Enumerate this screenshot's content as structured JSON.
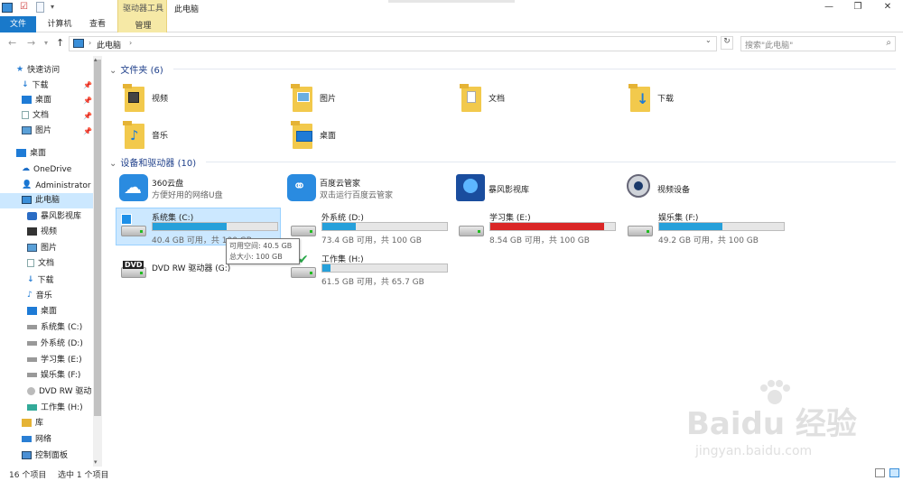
{
  "window": {
    "title": "此电脑",
    "minimize": "—",
    "restore": "❐",
    "close": "✕"
  },
  "ribbon": {
    "file_tab": "文件",
    "tabs": [
      "计算机",
      "查看"
    ],
    "tools_label": "驱动器工具",
    "manage_tab": "管理"
  },
  "address": {
    "path": "此电脑",
    "search_placeholder": "搜索\"此电脑\""
  },
  "nav": {
    "quick_access": "快速访问",
    "quick_items": [
      "下载",
      "桌面",
      "文档",
      "图片"
    ],
    "desktop": "桌面",
    "onedrive": "OneDrive",
    "user": "Administrator",
    "this_pc": "此电脑",
    "pc_items": [
      "暴风影视库",
      "视频",
      "图片",
      "文档",
      "下载",
      "音乐",
      "桌面",
      "系统集 (C:)",
      "外系统 (D:)",
      "学习集 (E:)",
      "娱乐集 (F:)",
      "DVD RW 驱动",
      "工作集 (H:)"
    ],
    "libraries": "库",
    "network": "网络",
    "control_panel": "控制面板"
  },
  "folders": {
    "heading": "文件夹 (6)",
    "items": [
      "视频",
      "图片",
      "文档",
      "下载",
      "音乐",
      "桌面"
    ]
  },
  "devices": {
    "heading": "设备和驱动器 (10)",
    "apps": [
      {
        "name": "360云盘",
        "sub": "方便好用的网络U盘"
      },
      {
        "name": "百度云管家",
        "sub": "双击运行百度云管家"
      },
      {
        "name": "暴风影视库",
        "sub": ""
      },
      {
        "name": "视频设备",
        "sub": ""
      }
    ],
    "drives": [
      {
        "name": "系统集 (C:)",
        "free": "40.4 GB 可用，共 100 GB",
        "used_pct": 59.6,
        "color": "#26a0da"
      },
      {
        "name": "外系统 (D:)",
        "free": "73.4 GB 可用，共 100 GB",
        "used_pct": 26.6,
        "color": "#26a0da"
      },
      {
        "name": "学习集 (E:)",
        "free": "8.54 GB 可用，共 100 GB",
        "used_pct": 91.5,
        "color": "#da2626"
      },
      {
        "name": "娱乐集 (F:)",
        "free": "49.2 GB 可用，共 100 GB",
        "used_pct": 50.8,
        "color": "#26a0da"
      },
      {
        "name": "DVD RW 驱动器 (G:)",
        "free": "",
        "used_pct": 0,
        "color": "#26a0da"
      },
      {
        "name": "工作集 (H:)",
        "free": "61.5 GB 可用，共 65.7 GB",
        "used_pct": 6.4,
        "color": "#26a0da"
      }
    ]
  },
  "tooltip": {
    "line1": "可用空间: 40.5 GB",
    "line2": "总大小: 100 GB"
  },
  "status": {
    "count": "16 个项目",
    "selected": "选中 1 个项目"
  },
  "watermark": {
    "brand": "Baidu 经验",
    "url": "jingyan.baidu.com"
  }
}
